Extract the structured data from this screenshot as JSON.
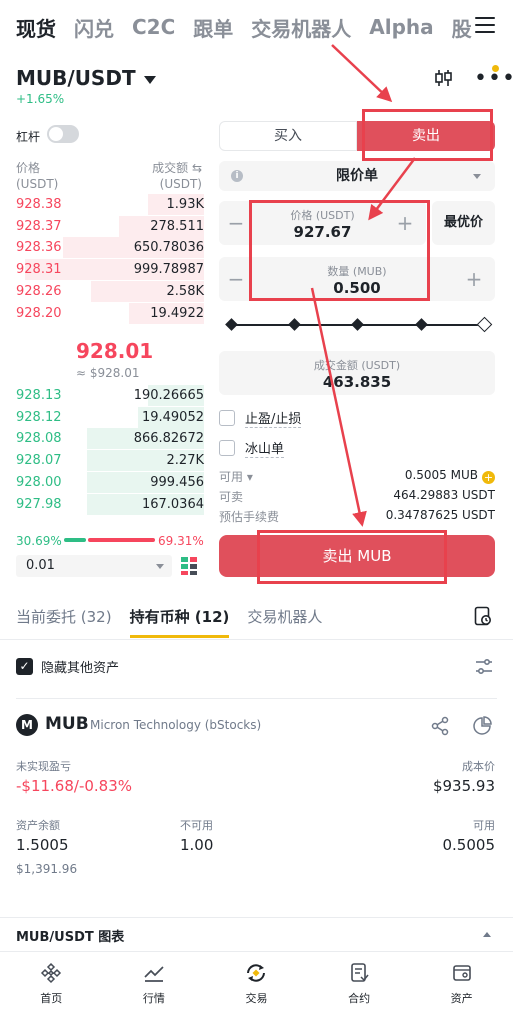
{
  "top_tabs": [
    "现货",
    "闪兑",
    "C2C",
    "跟单",
    "交易机器人",
    "Alpha",
    "股"
  ],
  "pair": {
    "symbol": "MUB/USDT",
    "change": "+1.65%"
  },
  "leverage_label": "杠杆",
  "orderbook": {
    "price_header": "价格",
    "price_unit": "(USDT)",
    "amount_header": "成交额 ⇆",
    "amount_unit": "(USDT)",
    "asks": [
      {
        "price": "928.38",
        "amount": "1.93K",
        "depth": 0.3
      },
      {
        "price": "928.37",
        "amount": "278.511",
        "depth": 0.45
      },
      {
        "price": "928.36",
        "amount": "650.78036",
        "depth": 0.75
      },
      {
        "price": "928.31",
        "amount": "999.78987",
        "depth": 0.95
      },
      {
        "price": "928.26",
        "amount": "2.58K",
        "depth": 0.6
      },
      {
        "price": "928.20",
        "amount": "19.4922",
        "depth": 0.4
      }
    ],
    "mid_price": "928.01",
    "mid_sub": "≈ $928.01",
    "bids": [
      {
        "price": "928.13",
        "amount": "190.26665",
        "depth": 0.3
      },
      {
        "price": "928.12",
        "amount": "19.49052",
        "depth": 0.35
      },
      {
        "price": "928.08",
        "amount": "866.82672",
        "depth": 0.62
      },
      {
        "price": "928.07",
        "amount": "2.27K",
        "depth": 0.62
      },
      {
        "price": "928.00",
        "amount": "999.456",
        "depth": 0.62
      },
      {
        "price": "927.98",
        "amount": "167.0364",
        "depth": 0.62
      }
    ],
    "buy_ratio": "30.69%",
    "sell_ratio": "69.31%",
    "precision": "0.01"
  },
  "form": {
    "buy_tab": "买入",
    "sell_tab": "卖出",
    "order_type": "限价单",
    "price_label": "价格 (USDT)",
    "price_value": "927.67",
    "best_price": "最优价",
    "qty_label": "数量 (MUB)",
    "qty_value": "0.500",
    "total_label": "成交金额 (USDT)",
    "total_value": "463.835",
    "tp_sl": "止盈/止损",
    "iceberg": "冰山单",
    "available_label": "可用",
    "available_value": "0.5005 MUB",
    "sellable_label": "可卖",
    "sellable_value": "464.29883 USDT",
    "fee_label": "预估手续费",
    "fee_value": "0.34787625 USDT",
    "submit": "卖出 MUB"
  },
  "section_tabs": [
    "当前委托 (32)",
    "持有币种 (12)",
    "交易机器人"
  ],
  "hide_other": "隐藏其他资产",
  "asset": {
    "logo_text": "M",
    "symbol": "MUB",
    "name": "Micron Technology (bStocks)",
    "pnl_label": "未实现盈亏",
    "pnl_value": "-$11.68/-0.83%",
    "cost_label": "成本价",
    "cost_value": "$935.93",
    "balance_label": "资产余额",
    "balance_value": "1.5005",
    "balance_usd": "$1,391.96",
    "unavailable_label": "不可用",
    "unavailable_value": "1.00",
    "available_label": "可用",
    "available_value": "0.5005"
  },
  "chart_bar": "MUB/USDT 图表",
  "bottom_nav": [
    "首页",
    "行情",
    "交易",
    "合约",
    "资产"
  ],
  "colors": {
    "sell": "#e0505c",
    "up": "#2ebd85",
    "down": "#f6465d",
    "accent": "#f0b90b"
  }
}
